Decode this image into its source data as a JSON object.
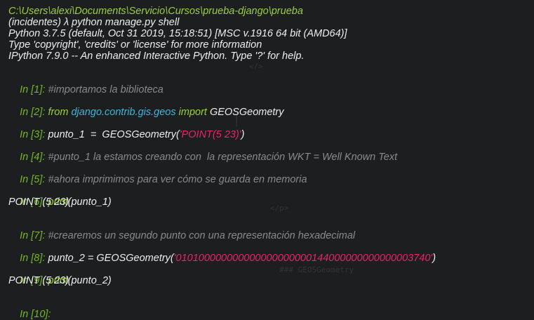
{
  "header": {
    "path": "C:\\Users\\alexi\\Documents\\Servicio\\Cursos\\prueba-django\\prueba",
    "command": "(incidentes) λ python manage.py shell",
    "python_info": "Python 3.7.5 (default, Oct 31 2019, 15:18:51) [MSC v.1916 64 bit (AMD64)]",
    "type_info": "Type 'copyright', 'credits' or 'license' for more information",
    "ipython_info": "IPython 7.9.0 -- An enhanced Interactive Python. Type '?' for help."
  },
  "cells": {
    "c1": {
      "prompt": "In [1]: ",
      "comment": "#importamos la biblioteca"
    },
    "c2": {
      "prompt": "In [2]: ",
      "from": "from ",
      "module": "django.contrib.gis.geos",
      "import": " import ",
      "name": "GEOSGeometry"
    },
    "c3": {
      "prompt": "In [3]: ",
      "pre": "punto_1  =  GEOSGeometry(",
      "str": "'POINT(5 23)'",
      "post": ")"
    },
    "c4": {
      "prompt": "In [4]: ",
      "comment": "#punto_1 la estamos creando con  la representación WKT = Well Known Text"
    },
    "c5": {
      "prompt": "In [5]: ",
      "comment": "#ahora imprimimos para ver cómo se guarda en memoria"
    },
    "c6": {
      "prompt": "In [6]: ",
      "func": "print",
      "args": "(punto_1)",
      "output": "POINT (5 23)"
    },
    "c7": {
      "prompt": "In [7]: ",
      "comment": "#crearemos un segundo punto con una representación hexadecimal"
    },
    "c8": {
      "prompt": "In [8]: ",
      "pre": "punto_2 = GEOSGeometry(",
      "str": "'010100000000000000000000144000000000000003740'",
      "post": ")"
    },
    "c9": {
      "prompt": "In [9]: ",
      "func": "print",
      "args": "(punto_2)",
      "output": "POINT (5 23)"
    },
    "c10": {
      "prompt": "In [10]: "
    }
  },
  "colors": {
    "background": "#1d1e20",
    "header_green": "#9bd13c",
    "prompt_green": "#73b824",
    "keyword_green": "#9bd13c",
    "module_cyan": "#3fb6d8",
    "string_pink": "#e8246c",
    "comment_gray": "#8a8a8a",
    "text_white": "#eeeeee"
  }
}
